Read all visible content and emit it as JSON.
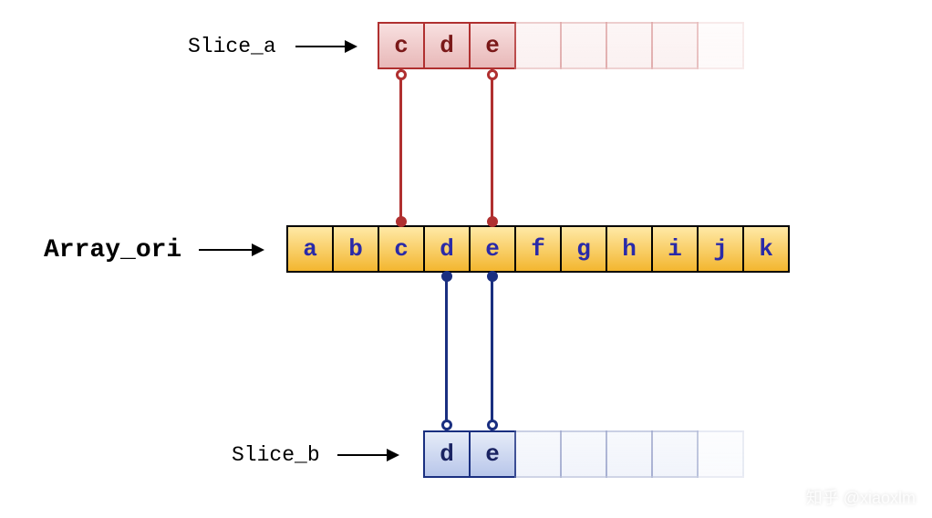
{
  "labels": {
    "slice_a": "Slice_a",
    "array_ori": "Array_ori",
    "slice_b": "Slice_b"
  },
  "array_ori": [
    "a",
    "b",
    "c",
    "d",
    "e",
    "f",
    "g",
    "h",
    "i",
    "j",
    "k"
  ],
  "slice_a": {
    "values": [
      "c",
      "d",
      "e"
    ],
    "ghost_cells": 5,
    "points_to": {
      "start_index": 2,
      "end_index": 4
    }
  },
  "slice_b": {
    "values": [
      "d",
      "e"
    ],
    "ghost_cells": 5,
    "points_to": {
      "start_index": 3,
      "end_index": 4
    }
  },
  "watermark": "知乎 @xiaoxlm",
  "colors": {
    "red": "#b03030",
    "blue": "#1a2f80",
    "orange_top": "#ffe9a6",
    "orange_bot": "#f3b62f",
    "array_text": "#2a2aa8"
  },
  "chart_data": {
    "type": "other",
    "description": "Go-style slice diagram: two slices aliasing parts of a backing array",
    "backing_array": [
      "a",
      "b",
      "c",
      "d",
      "e",
      "f",
      "g",
      "h",
      "i",
      "j",
      "k"
    ],
    "slices": [
      {
        "name": "Slice_a",
        "start": 2,
        "len": 3,
        "cap": 8,
        "elements": [
          "c",
          "d",
          "e"
        ]
      },
      {
        "name": "Slice_b",
        "start": 3,
        "len": 2,
        "cap": 7,
        "elements": [
          "d",
          "e"
        ]
      }
    ]
  }
}
